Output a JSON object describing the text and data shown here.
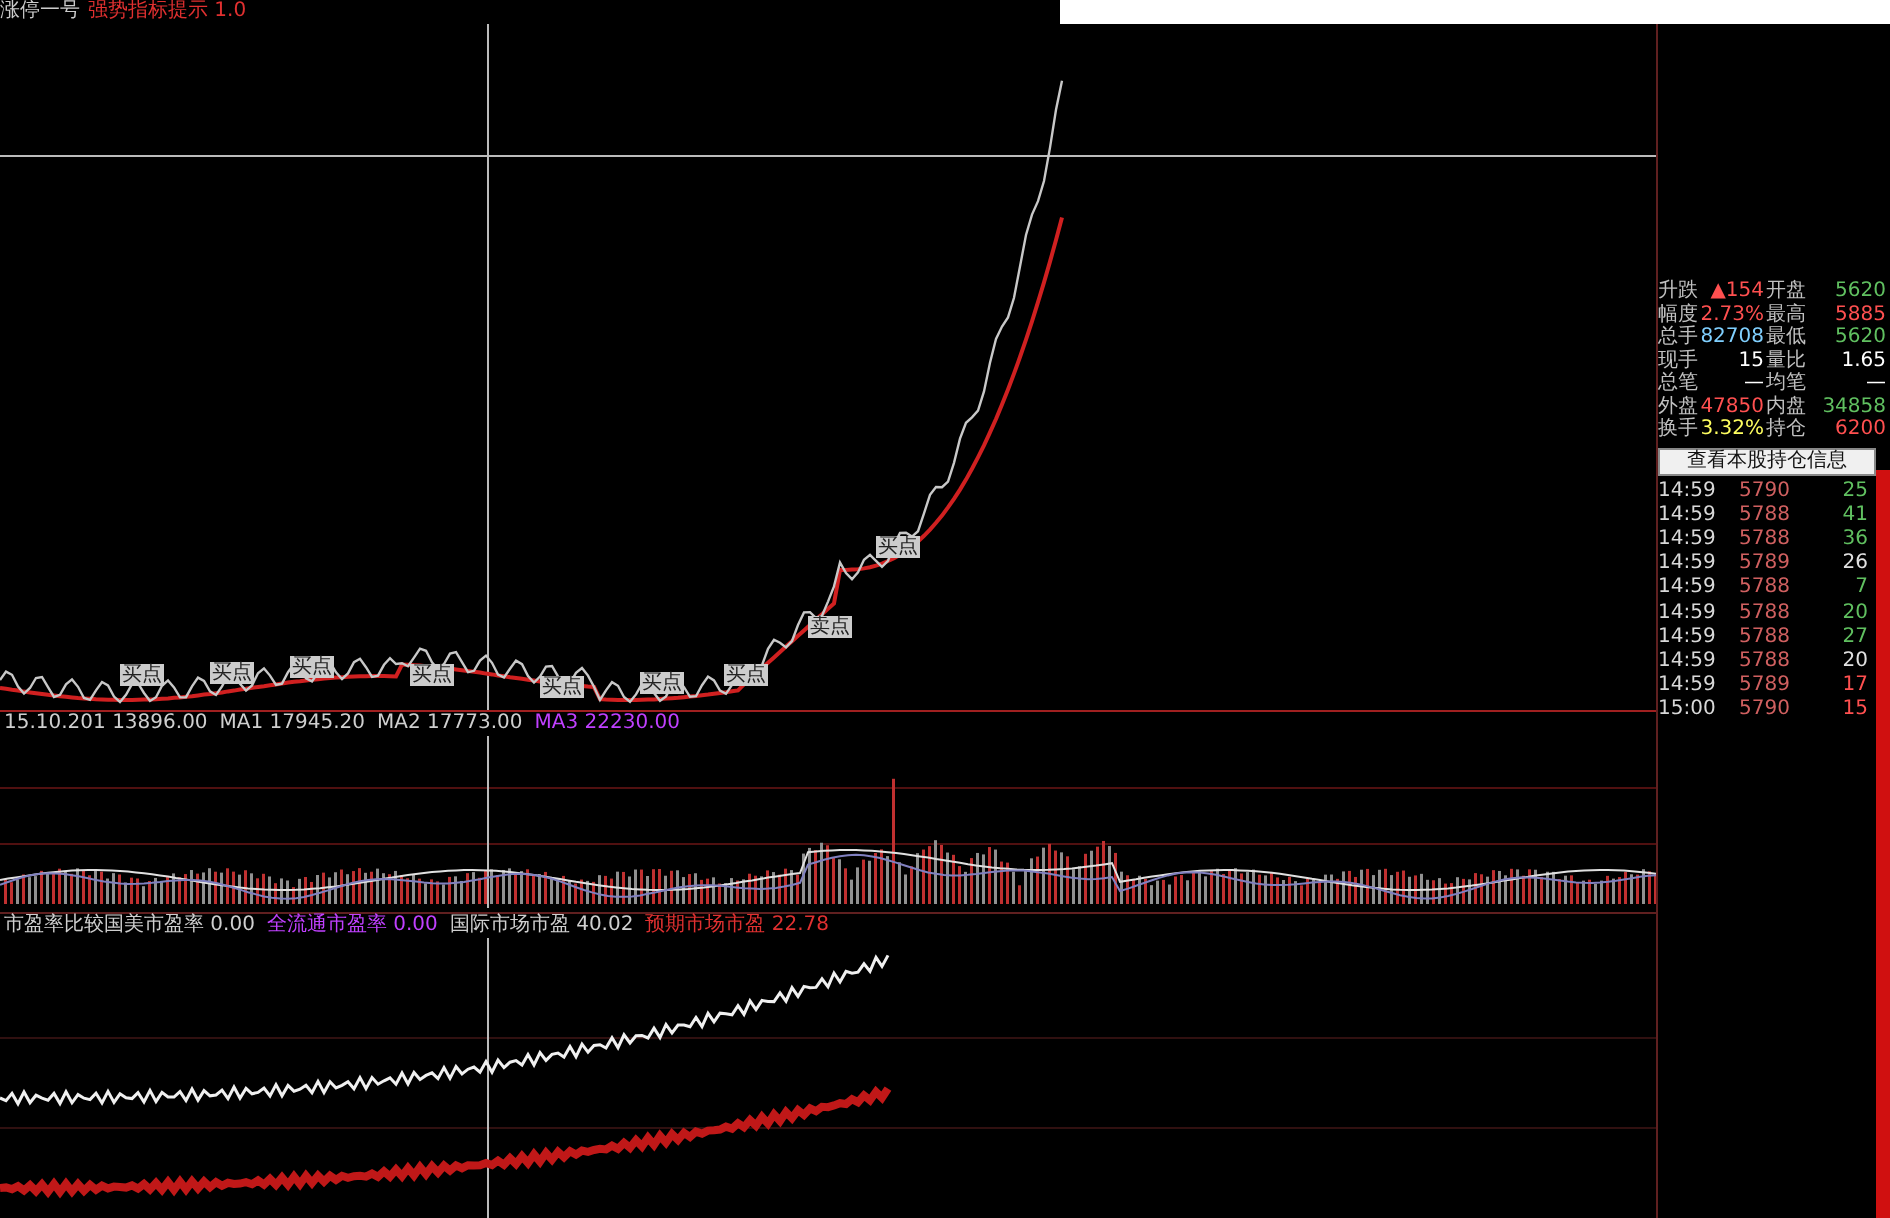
{
  "header": {
    "title": "涨停一号",
    "indicator": "强势指标提示 1.0"
  },
  "main_chart": {
    "markers": [
      {
        "label": "买点"
      },
      {
        "label": "买点"
      },
      {
        "label": "买点"
      },
      {
        "label": "买点"
      },
      {
        "label": "买点"
      },
      {
        "label": "买点"
      },
      {
        "label": "买点"
      },
      {
        "label": "卖点"
      },
      {
        "label": "买点"
      }
    ]
  },
  "volume_chart": {
    "legend": [
      {
        "text": "15.10.201  13896.00",
        "color": "#cfcfcf"
      },
      {
        "text": "MA1 17945.20",
        "color": "#cfcfcf"
      },
      {
        "text": "MA2 17773.00",
        "color": "#cfcfcf"
      },
      {
        "text": "MA3 22230.00",
        "color": "#c040ff"
      }
    ]
  },
  "indicator_chart": {
    "legend": [
      {
        "text": "市盈率比较国美市盈率 0.00",
        "color": "#cfcfcf"
      },
      {
        "text": "全流通市盈率 0.00",
        "color": "#c040ff"
      },
      {
        "text": "国际市场市盈 40.02",
        "color": "#cfcfcf"
      },
      {
        "text": "预期市场市盈 22.78",
        "color": "#e03030"
      }
    ]
  },
  "quote": [
    {
      "label": "升跌",
      "value": {
        "text": "▲154",
        "color": "#ff5050"
      },
      "label2": "开盘",
      "value2": {
        "text": "5620",
        "color": "#60c060"
      }
    },
    {
      "label": "幅度",
      "value": {
        "text": "2.73%",
        "color": "#ff5050"
      },
      "label2": "最高",
      "value2": {
        "text": "5885",
        "color": "#ff5050"
      }
    },
    {
      "label": "总手",
      "value": {
        "text": "82708",
        "color": "#80d0ff"
      },
      "label2": "最低",
      "value2": {
        "text": "5620",
        "color": "#60c060"
      }
    },
    {
      "label": "现手",
      "value": {
        "text": "15",
        "color": "#ffffff"
      },
      "label2": "量比",
      "value2": {
        "text": "1.65",
        "color": "#ffffff"
      }
    },
    {
      "label": "总笔",
      "value": {
        "text": "—",
        "color": "#ffffff"
      },
      "label2": "均笔",
      "value2": {
        "text": "—",
        "color": "#ffffff"
      }
    },
    {
      "label": "外盘",
      "value": {
        "text": "47850",
        "color": "#ff5050"
      },
      "label2": "内盘",
      "value2": {
        "text": "34858",
        "color": "#60c060"
      }
    },
    {
      "label": "换手",
      "value": {
        "text": "3.32%",
        "color": "#ffff60"
      },
      "label2": "持仓",
      "value2": {
        "text": "6200",
        "color": "#ff5050"
      }
    }
  ],
  "holding_button": "查看本股持仓信息",
  "ticks": [
    {
      "time": "14:59",
      "price": "5790",
      "volume": "25",
      "color": "#60c060"
    },
    {
      "time": "14:59",
      "price": "5788",
      "volume": "41",
      "color": "#60c060"
    },
    {
      "time": "14:59",
      "price": "5788",
      "volume": "36",
      "color": "#60c060"
    },
    {
      "time": "14:59",
      "price": "5789",
      "volume": "26",
      "color": "#e0e0e0"
    },
    {
      "time": "14:59",
      "price": "5788",
      "volume": "7",
      "color": "#60c060"
    },
    {
      "time": "14:59",
      "price": "5788",
      "volume": "20",
      "color": "#60c060"
    },
    {
      "time": "14:59",
      "price": "5788",
      "volume": "27",
      "color": "#60c060"
    },
    {
      "time": "14:59",
      "price": "5788",
      "volume": "20",
      "color": "#e0e0e0"
    },
    {
      "time": "14:59",
      "price": "5789",
      "volume": "17",
      "color": "#ff5050"
    },
    {
      "time": "15:00",
      "price": "5790",
      "volume": "15",
      "color": "#ff5050"
    }
  ]
}
